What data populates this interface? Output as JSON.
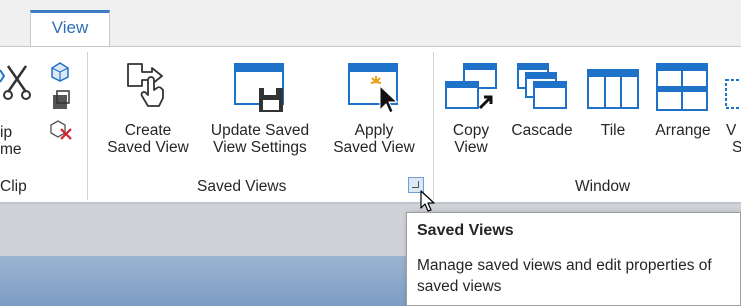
{
  "tabs": {
    "active": "View"
  },
  "clip_group": {
    "label": "Clip",
    "partial_label_line1": "ip",
    "partial_label_line2": "me"
  },
  "saved_views_group": {
    "label": "Saved Views",
    "create": {
      "line1": "Create",
      "line2": "Saved View"
    },
    "update": {
      "line1": "Update Saved",
      "line2": "View Settings"
    },
    "apply": {
      "line1": "Apply",
      "line2": "Saved View"
    }
  },
  "window_group": {
    "label": "Window",
    "copy": {
      "line1": "Copy",
      "line2": "View"
    },
    "cascade": {
      "label": "Cascade"
    },
    "tile": {
      "label": "Tile"
    },
    "arrange": {
      "label": "Arrange"
    },
    "partial": {
      "line1": "V",
      "line2": "S"
    }
  },
  "tooltip": {
    "title": "Saved Views",
    "text": "Manage saved views and edit properties of saved views"
  },
  "colors": {
    "accent": "#3d7bc4",
    "icon_blue": "#1e73c8",
    "ribbon_bg": "#ffffff",
    "workspace": "#cfd3d8"
  }
}
